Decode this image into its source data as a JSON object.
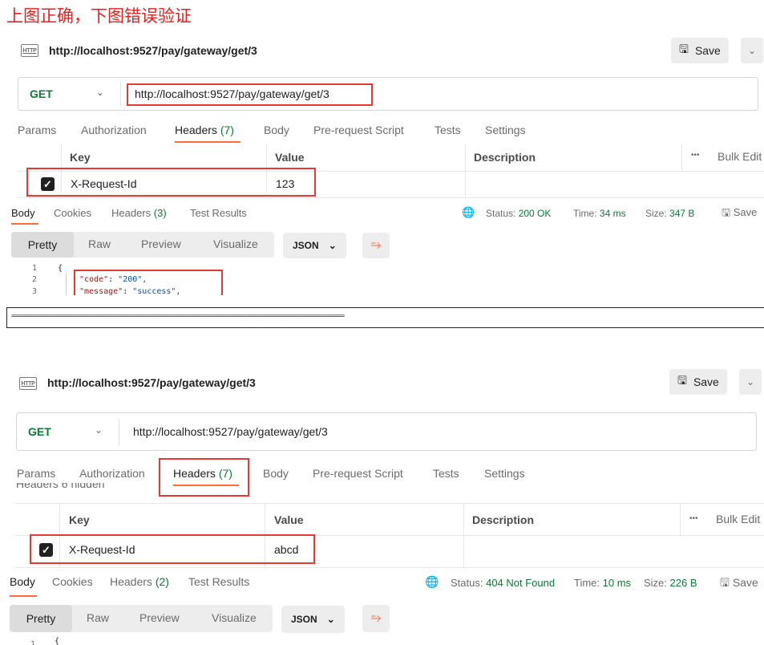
{
  "caption": "上图正确，下图错误验证",
  "separator": "==========================================================================================================",
  "panels": [
    {
      "http_badge": "HTTP",
      "title_url": "http://localhost:9527/pay/gateway/get/3",
      "save_label": "Save",
      "method": "GET",
      "url": "http://localhost:9527/pay/gateway/get/3",
      "tabs": [
        "Params",
        "Authorization",
        "Headers",
        "Body",
        "Pre-request Script",
        "Tests",
        "Settings"
      ],
      "headers_count": "(7)",
      "hidden_label": "",
      "table_headers": {
        "key": "Key",
        "value": "Value",
        "description": "Description",
        "more": "•••",
        "bulk": "Bulk Edit"
      },
      "row": {
        "key": "X-Request-Id",
        "value": "123"
      },
      "resp_tabs": [
        "Body",
        "Cookies",
        "Headers",
        "Test Results"
      ],
      "resp_headers_count": "(3)",
      "status_label": "Status:",
      "status_value": "200 OK",
      "time_label": "Time:",
      "time_value": "34 ms",
      "size_label": "Size:",
      "size_value": "347 B",
      "save_response": "Save",
      "formats": [
        "Pretty",
        "Raw",
        "Preview",
        "Visualize"
      ],
      "json_label": "JSON",
      "code_lines": [
        {
          "n": "1",
          "text": "{"
        },
        {
          "n": "2",
          "key": "\"code\"",
          "val": "\"200\","
        },
        {
          "n": "3",
          "key": "\"message\"",
          "val": "\"success\","
        }
      ]
    },
    {
      "http_badge": "HTTP",
      "title_url": "http://localhost:9527/pay/gateway/get/3",
      "save_label": "Save",
      "method": "GET",
      "url": "http://localhost:9527/pay/gateway/get/3",
      "tabs": [
        "Params",
        "Authorization",
        "Headers",
        "Body",
        "Pre-request Script",
        "Tests",
        "Settings"
      ],
      "headers_count": "(7)",
      "hidden_label": "Headers   6 hidden",
      "table_headers": {
        "key": "Key",
        "value": "Value",
        "description": "Description",
        "more": "•••",
        "bulk": "Bulk Edit"
      },
      "row": {
        "key": "X-Request-Id",
        "value": "abcd"
      },
      "resp_tabs": [
        "Body",
        "Cookies",
        "Headers",
        "Test Results"
      ],
      "resp_headers_count": "(2)",
      "status_label": "Status:",
      "status_value": "404 Not Found",
      "time_label": "Time:",
      "time_value": "10 ms",
      "size_label": "Size:",
      "size_value": "226 B",
      "save_response": "Save",
      "formats": [
        "Pretty",
        "Raw",
        "Preview",
        "Visualize"
      ],
      "json_label": "JSON",
      "code_lines": [
        {
          "n": "1",
          "text": "{"
        }
      ]
    }
  ]
}
